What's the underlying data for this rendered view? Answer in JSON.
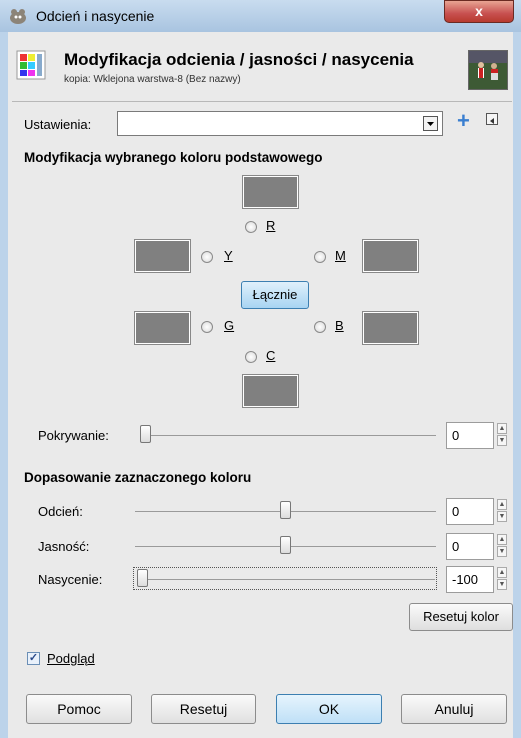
{
  "window": {
    "title": "Odcień i nasycenie",
    "close_glyph": "x"
  },
  "header": {
    "title": "Modyfikacja odcienia / jasności / nasycenia",
    "subtitle": "kopia: Wklejona warstwa-8 (Bez nazwy)"
  },
  "settings": {
    "label": "Ustawienia:",
    "value": "",
    "add_glyph": "+"
  },
  "primary": {
    "heading": "Modyfikacja wybranego koloru podstawowego",
    "r": "R",
    "y": "Y",
    "m": "M",
    "g": "G",
    "b": "B",
    "c": "C",
    "all_button": "Łącznie"
  },
  "overlap": {
    "label": "Pokrywanie:",
    "value": "0",
    "level": 0
  },
  "adjust": {
    "heading": "Dopasowanie zaznaczonego koloru",
    "hue": {
      "label": "Odcień:",
      "value": "0",
      "level": 0.5
    },
    "lightness": {
      "label": "Jasność:",
      "value": "0",
      "level": 0.5
    },
    "saturation": {
      "label": "Nasycenie:",
      "value": "-100",
      "level": 0
    }
  },
  "reset_color_button": "Resetuj kolor",
  "preview": {
    "label": "Podgląd",
    "checked": true,
    "check_glyph": "✓"
  },
  "buttons": {
    "help": "Pomoc",
    "reset": "Resetuj",
    "ok": "OK",
    "cancel": "Anuluj"
  },
  "icons": {
    "app": "gimp-icon",
    "header": "hue-saturation-icon",
    "thumb": "layer-thumbnail",
    "add": "add-icon",
    "menu": "menu-arrow-icon"
  }
}
